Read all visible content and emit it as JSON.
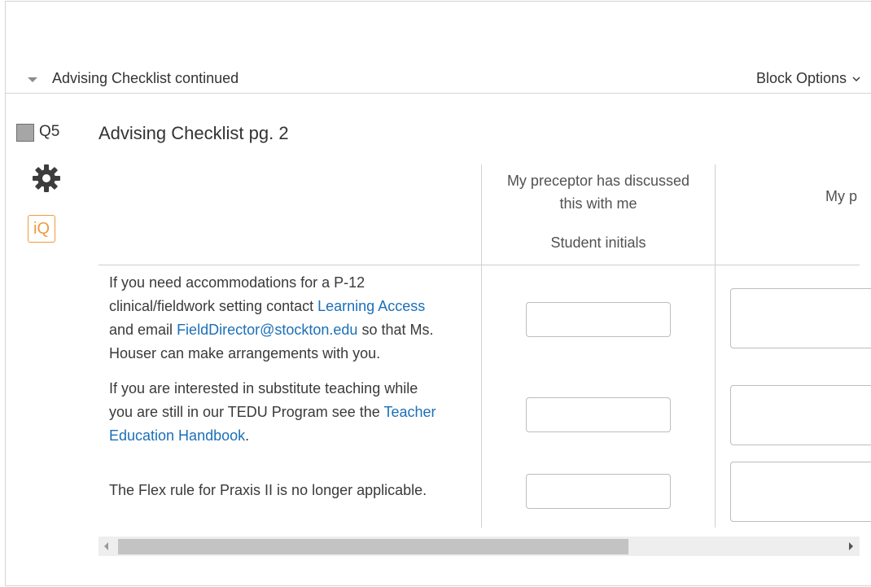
{
  "block": {
    "title": "Advising Checklist continued",
    "options_label": "Block Options"
  },
  "question": {
    "number": "Q5",
    "title": "Advising Checklist pg. 2",
    "iq_label": "iQ"
  },
  "matrix": {
    "columns": [
      {
        "line1": "My preceptor has discussed",
        "line2": "this with me",
        "line3": "Student initials"
      },
      {
        "line1": "My p"
      }
    ],
    "rows": [
      {
        "t1": "If you need accommodations for a P-12",
        "t2a": "clinical/fieldwork setting contact ",
        "link1": "Learning Access",
        "t3a": "and email ",
        "link2": "FieldDirector@stockton.edu",
        "t3b": " so that Ms.",
        "t4": "Houser can make arrangements with you."
      },
      {
        "t1": "If you are interested in substitute teaching while",
        "t2a": "you are still in our TEDU Program see the ",
        "link1": "Teacher",
        "link1b": "Education Handbook",
        "t3b": "."
      },
      {
        "t1": "The Flex rule for Praxis II is no longer applicable."
      }
    ]
  },
  "colors": {
    "link": "#1b6fb8",
    "iq_accent": "#f29a3a"
  }
}
